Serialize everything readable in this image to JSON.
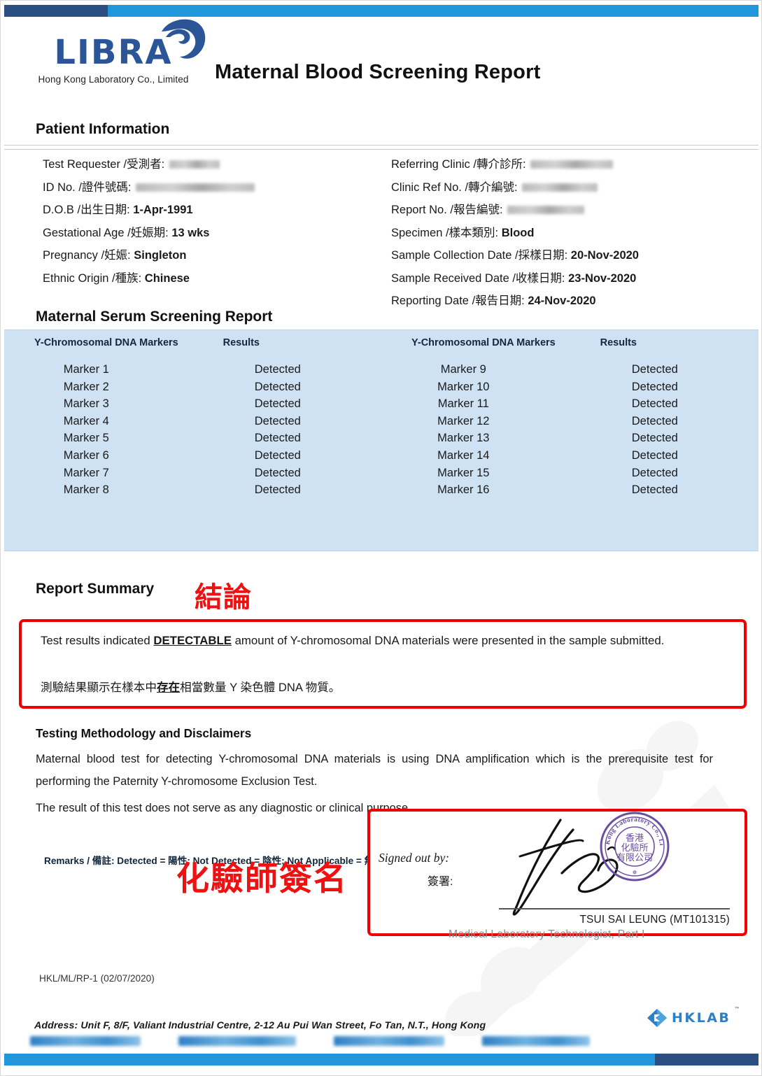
{
  "document": {
    "form_code": "HKL/ML/RP-1 (02/07/2020)"
  },
  "header": {
    "logo_wordmark": "LIBRA",
    "logo_subtitle": "Hong Kong Laboratory Co., Limited",
    "report_title": "Maternal Blood Screening Report"
  },
  "patient_information": {
    "heading": "Patient Information",
    "left": [
      {
        "label": "Test Requester /受測者:",
        "value": "",
        "redacted": true,
        "redacted_width": 72
      },
      {
        "label": "ID No. /證件號碼:",
        "value": "",
        "redacted": true,
        "redacted_width": 170
      },
      {
        "label": "D.O.B /出生日期:",
        "value": "1-Apr-1991",
        "redacted": false
      },
      {
        "label": "Gestational Age /妊娠期:",
        "value": "13 wks",
        "redacted": false
      },
      {
        "label": "Pregnancy /妊娠:",
        "value": "Singleton",
        "redacted": false
      },
      {
        "label": "Ethnic Origin /種族:",
        "value": "Chinese",
        "redacted": false
      }
    ],
    "right": [
      {
        "label": "Referring Clinic /轉介診所:",
        "value": "",
        "redacted": true,
        "redacted_width": 118
      },
      {
        "label": "Clinic Ref No. /轉介編號:",
        "value": "",
        "redacted": true,
        "redacted_width": 108
      },
      {
        "label": "Report No. /報告編號:",
        "value": "",
        "redacted": true,
        "redacted_width": 110
      },
      {
        "label": "Specimen /樣本類別:",
        "value": "Blood",
        "redacted": false
      },
      {
        "label": "Sample Collection Date /採樣日期:",
        "value": "20-Nov-2020",
        "redacted": false
      },
      {
        "label": "Sample Received Date /收樣日期:",
        "value": "23-Nov-2020",
        "redacted": false
      },
      {
        "label": "Reporting Date /報告日期:",
        "value": "24-Nov-2020",
        "redacted": false
      }
    ]
  },
  "serum_screening": {
    "heading": "Maternal Serum Screening Report",
    "columns": [
      "Y-Chromosomal DNA Markers",
      "Results"
    ],
    "left_rows": [
      {
        "marker": "Marker 1",
        "result": "Detected"
      },
      {
        "marker": "Marker 2",
        "result": "Detected"
      },
      {
        "marker": "Marker 3",
        "result": "Detected"
      },
      {
        "marker": "Marker 4",
        "result": "Detected"
      },
      {
        "marker": "Marker 5",
        "result": "Detected"
      },
      {
        "marker": "Marker 6",
        "result": "Detected"
      },
      {
        "marker": "Marker 7",
        "result": "Detected"
      },
      {
        "marker": "Marker 8",
        "result": "Detected"
      }
    ],
    "right_rows": [
      {
        "marker": "Marker 9",
        "result": "Detected"
      },
      {
        "marker": "Marker 10",
        "result": "Detected"
      },
      {
        "marker": "Marker 11",
        "result": "Detected"
      },
      {
        "marker": "Marker 12",
        "result": "Detected"
      },
      {
        "marker": "Marker 13",
        "result": "Detected"
      },
      {
        "marker": "Marker 14",
        "result": "Detected"
      },
      {
        "marker": "Marker 15",
        "result": "Detected"
      },
      {
        "marker": "Marker 16",
        "result": "Detected"
      }
    ],
    "remarks": "Remarks /  備註: Detected =  陽性; Not Detected =  陰性; Not Applicable =  無法檢測"
  },
  "report_summary": {
    "heading": "Report Summary",
    "zh_annotation": "結論",
    "text_before": "Test results indicated ",
    "text_emphasis": "DETECTABLE",
    "text_after": " amount of Y-chromosomal DNA materials were presented in the sample submitted.",
    "text_zh_before": "測驗結果顯示在樣本中",
    "text_zh_emphasis": "存在",
    "text_zh_after": "相當數量 Y 染色體 DNA 物質。"
  },
  "methodology": {
    "heading": "Testing Methodology and Disclaimers",
    "paragraph_1": "Maternal blood test for detecting Y-chromosomal DNA materials is using DNA amplification which is the prerequisite test for performing the Paternity Y-chromosome Exclusion Test.",
    "paragraph_2": "The result of this test does not serve as any diagnostic or clinical purpose."
  },
  "signature": {
    "zh_annotation": "化驗師簽名",
    "signed_out_label": "Signed out by:",
    "signed_out_label_zh": "簽署:",
    "signatory_name": "TSUI SAI LEUNG (MT101315)",
    "signatory_role": "Medical Laboratory Technologist, Part I",
    "stamp_text_en": "Hong Kong Laboratory Co., Limited",
    "stamp_text_zh": "香港 化驗所 有限公司"
  },
  "footer": {
    "address": "Address: Unit F, 8/F, Valiant Industrial Centre, 2-12 Au Pui Wan Street, Fo Tan, N.T., Hong Kong",
    "hklab_logo_text": "HKLAB",
    "hklab_tm": "™"
  },
  "colors": {
    "bar_dark_blue": "#2b4f81",
    "bar_light_blue": "#2196da",
    "table_band": "#cfe2f4",
    "annotation_red": "#ee1111",
    "logo_blue": "#2b5596",
    "stamp_purple": "#6b4f9e"
  }
}
